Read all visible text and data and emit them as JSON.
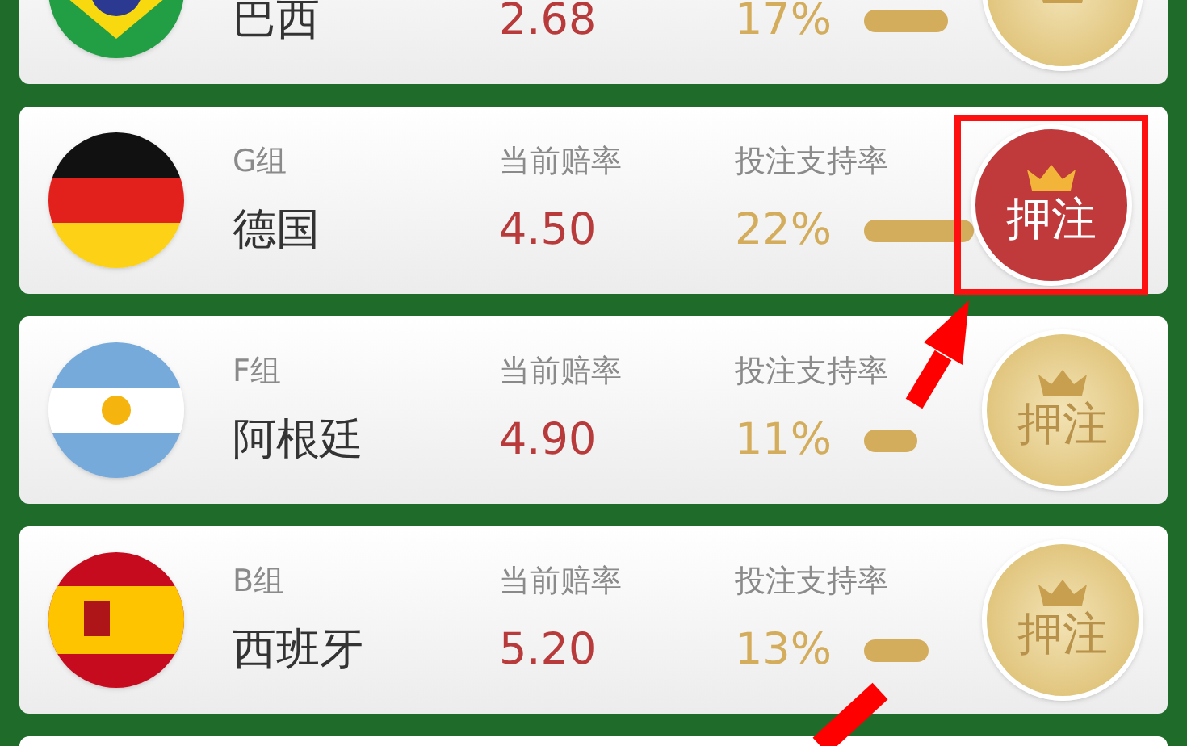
{
  "rows": [
    {
      "name": "巴西",
      "odds": "2.68",
      "support": "17%",
      "selected": false
    },
    {
      "group": "G组",
      "odds_label": "当前赔率",
      "support_label": "投注支持率",
      "name": "德国",
      "odds": "4.50",
      "support": "22%",
      "button": "押注",
      "selected": true
    },
    {
      "group": "F组",
      "odds_label": "当前赔率",
      "support_label": "投注支持率",
      "name": "阿根廷",
      "odds": "4.90",
      "support": "11%",
      "button": "押注",
      "selected": false
    },
    {
      "group": "B组",
      "odds_label": "当前赔率",
      "support_label": "投注支持率",
      "name": "西班牙",
      "odds": "5.20",
      "support": "13%",
      "button": "押注",
      "selected": false
    }
  ]
}
